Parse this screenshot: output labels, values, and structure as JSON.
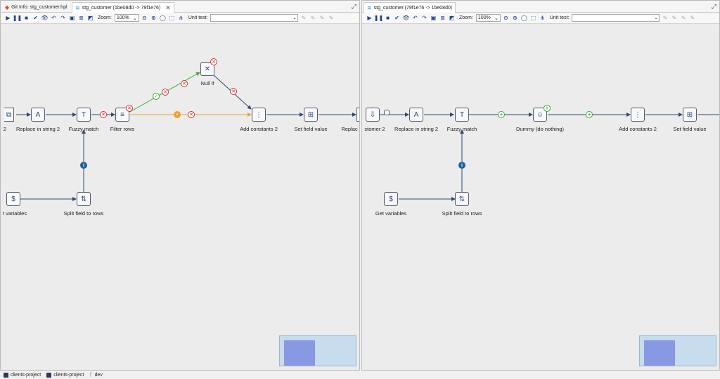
{
  "left_pane": {
    "tabs": [
      {
        "label": "Git Info: stg_customer.hpl",
        "icon": "git-icon",
        "color": "#e04a2a"
      },
      {
        "label": "stg_customer (1be08d0 -> 79f1e76)",
        "icon": "pipeline-icon",
        "color": "#3a8fd6",
        "close": "✕"
      }
    ],
    "toolbar": {
      "zoom_label": "Zoom:",
      "zoom_value": "100%",
      "unit_test_label": "Unit test:",
      "unit_test_value": ""
    },
    "steps": [
      {
        "label": "2",
        "glyph": "⧉"
      },
      {
        "label": "Replace in string 2",
        "glyph": "A"
      },
      {
        "label": "Fuzzy match",
        "glyph": "T"
      },
      {
        "label": "Filter rows",
        "glyph": "≡"
      },
      {
        "label": "Null if",
        "glyph": "✕"
      },
      {
        "label": "Add constants 2",
        "glyph": "⋮"
      },
      {
        "label": "Set field value",
        "glyph": "⊞"
      },
      {
        "label": "Replac",
        "glyph": "A"
      },
      {
        "label": "t variables",
        "glyph": "$"
      },
      {
        "label": "Split field to rows",
        "glyph": "⇅"
      }
    ]
  },
  "right_pane": {
    "tabs": [
      {
        "label": "stg_customer (79f1e76 -> 1be08d0)",
        "icon": "pipeline-icon",
        "color": "#3a8fd6"
      }
    ],
    "toolbar": {
      "zoom_label": "Zoom:",
      "zoom_value": "100%",
      "unit_test_label": "Unit test:",
      "unit_test_value": ""
    },
    "steps": [
      {
        "label": "stomer 2",
        "glyph": "⇩"
      },
      {
        "label": "Replace in string 2",
        "glyph": "A"
      },
      {
        "label": "Fuzzy match",
        "glyph": "T"
      },
      {
        "label": "Dummy (do nothing)",
        "glyph": "☺"
      },
      {
        "label": "Add constants 2",
        "glyph": "⋮"
      },
      {
        "label": "Set field value",
        "glyph": "⊞"
      },
      {
        "label": "Get variables",
        "glyph": "$"
      },
      {
        "label": "Split field to rows",
        "glyph": "⇅"
      }
    ]
  },
  "statusbar": {
    "items": [
      {
        "label": "clients-project",
        "icon": "folder-icon"
      },
      {
        "label": "clients-project",
        "icon": "box-icon"
      },
      {
        "label": "dev",
        "icon": "branch-icon"
      }
    ]
  },
  "colors": {
    "hop": "#2c4a72",
    "added": "#3aaa35",
    "removed": "#d23333",
    "changed": "#f0a030",
    "info": "#1f5f9f"
  }
}
